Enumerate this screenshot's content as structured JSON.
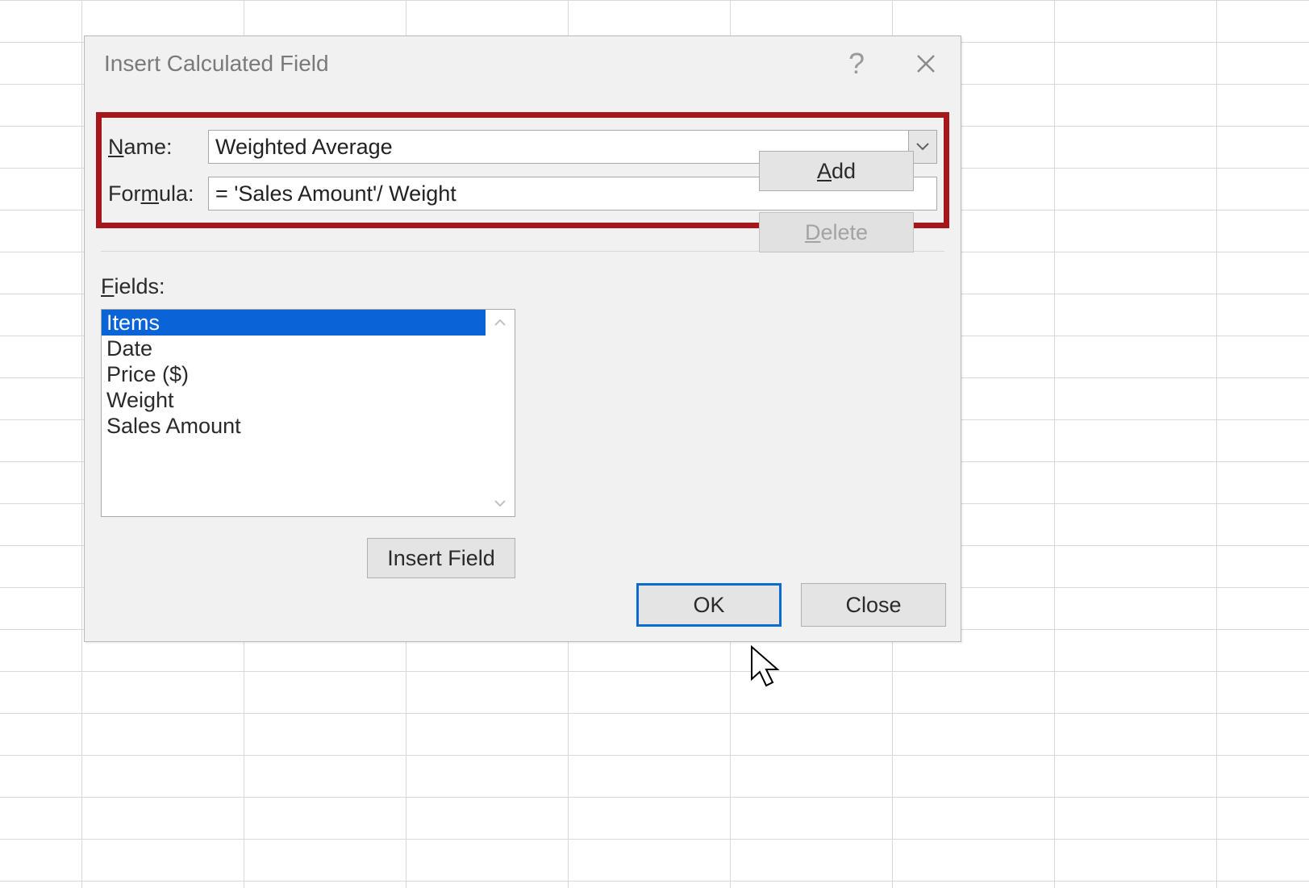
{
  "dialog": {
    "title": "Insert Calculated Field",
    "labels": {
      "name_prefix": "N",
      "name_suffix": "ame:",
      "formula_prefix": "For",
      "formula_mid": "m",
      "formula_suffix": "ula:",
      "fields_prefix": "F",
      "fields_suffix": "ields:"
    },
    "name_value": "Weighted Average",
    "formula_value": "= 'Sales Amount'/ Weight",
    "fields": [
      {
        "label": "Items",
        "selected": true
      },
      {
        "label": "Date",
        "selected": false
      },
      {
        "label": "Price ($)",
        "selected": false
      },
      {
        "label": "Weight",
        "selected": false
      },
      {
        "label": "Sales Amount",
        "selected": false
      }
    ],
    "buttons": {
      "add_prefix": "A",
      "add_suffix": "dd",
      "delete_prefix": "D",
      "delete_suffix": "elete",
      "insert_field": "Insert Field",
      "ok": "OK",
      "close": "Close"
    }
  }
}
